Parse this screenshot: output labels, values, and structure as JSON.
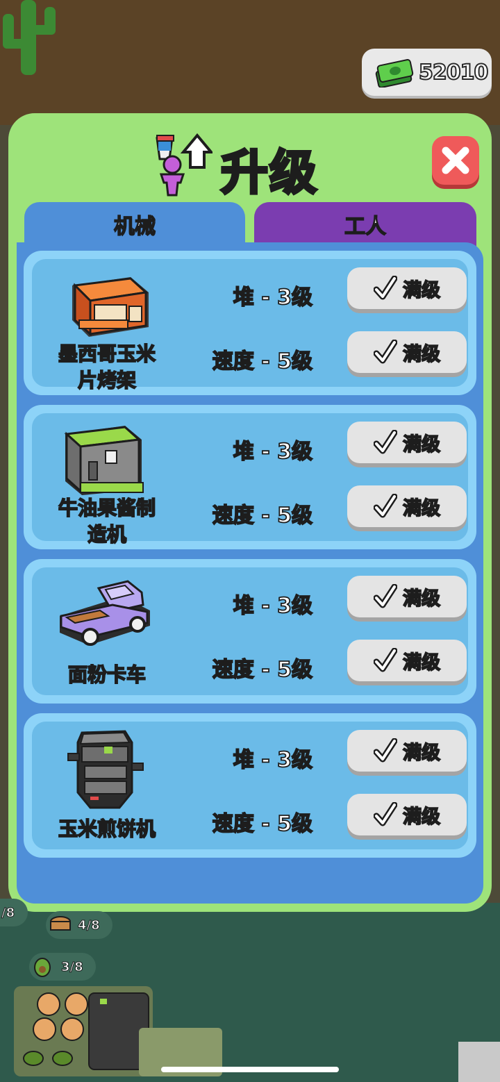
{
  "money": {
    "icon": "cash-stack-icon",
    "value": "52010"
  },
  "dialog": {
    "title": "升级",
    "title_icon": "worker-upgrade-icon",
    "close_icon": "close-icon"
  },
  "tabs": [
    {
      "label": "机械",
      "active": true
    },
    {
      "label": "工人",
      "active": false
    }
  ],
  "machines": [
    {
      "name": "墨西哥玉米片烤架",
      "name_lines": [
        "墨西哥玉米",
        "片烤架"
      ],
      "icon": "nacho-grill-icon",
      "stats": [
        {
          "label": "堆 - 3级",
          "button": "满级"
        },
        {
          "label": "速度 - 5级",
          "button": "满级"
        }
      ]
    },
    {
      "name": "牛油果酱制造机",
      "name_lines": [
        "牛油果酱制",
        "造机"
      ],
      "icon": "guacamole-machine-icon",
      "stats": [
        {
          "label": "堆 - 3级",
          "button": "满级"
        },
        {
          "label": "速度 - 5级",
          "button": "满级"
        }
      ]
    },
    {
      "name": "面粉卡车",
      "name_lines": [
        "面粉卡车"
      ],
      "icon": "flour-truck-icon",
      "stats": [
        {
          "label": "堆 - 3级",
          "button": "满级"
        },
        {
          "label": "速度 - 5级",
          "button": "满级"
        }
      ]
    },
    {
      "name": "玉米煎饼机",
      "name_lines": [
        "玉米煎饼机"
      ],
      "icon": "burrito-machine-icon",
      "stats": [
        {
          "label": "堆 - 3级",
          "button": "满级"
        },
        {
          "label": "速度 - 5级",
          "button": "满级"
        }
      ]
    }
  ],
  "hud": [
    {
      "label": "/8"
    },
    {
      "label": "4/8",
      "icon": "tortilla-icon"
    },
    {
      "label": "3/8",
      "icon": "avocado-icon"
    }
  ],
  "colors": {
    "panel": "#9ee37a",
    "tab_machine": "#4f8fd8",
    "tab_worker": "#7b3db0",
    "close": "#ef5a5a"
  }
}
